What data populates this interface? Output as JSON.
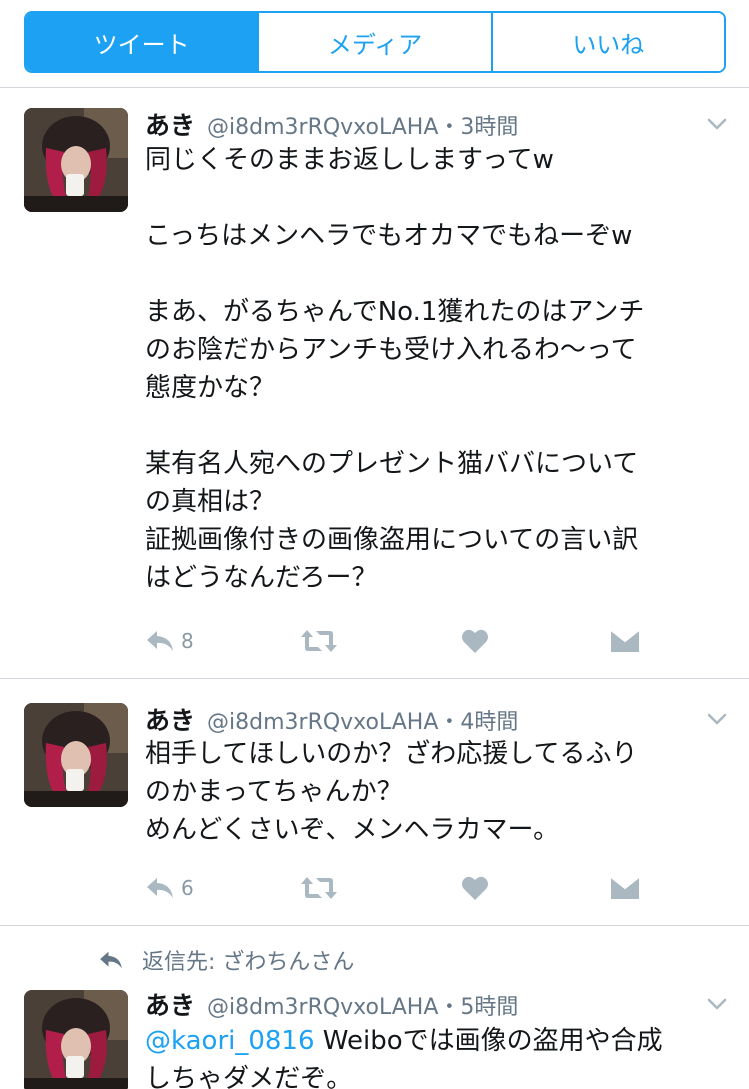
{
  "tabs": [
    {
      "label": "ツイート",
      "active": true
    },
    {
      "label": "メディア",
      "active": false
    },
    {
      "label": "いいね",
      "active": false
    }
  ],
  "tweets": [
    {
      "name": "あき",
      "handle": "@i8dm3rRQvxoLAHA・3時間",
      "lines": [
        "同じくそのままお返ししますってw",
        "",
        "こっちはメンヘラでもオカマでもねーぞw",
        "",
        "まあ、がるちゃんでNo.1獲れたのはアンチ",
        "のお陰だからアンチも受け入れるわ〜って",
        "態度かな？",
        "",
        "某有名人宛へのプレゼント猫ババについて",
        "の真相は？",
        "証拠画像付きの画像盗用についての言い訳",
        "はどうなんだろー？"
      ],
      "reply_count": "8"
    },
    {
      "name": "あき",
      "handle": "@i8dm3rRQvxoLAHA・4時間",
      "lines": [
        "相手してほしいのか？ざわ応援してるふり",
        "のかまってちゃんか？",
        "めんどくさいぞ、メンヘラカマー。"
      ],
      "reply_count": "6"
    },
    {
      "context": "返信先: ざわちんさん",
      "name": "あき",
      "handle": "@i8dm3rRQvxoLAHA・5時間",
      "mention": "@kaori_0816",
      "line1_rest": " Weiboでは画像の盗用や合成",
      "line2": "しちゃダメだぞ。"
    }
  ],
  "icons": {
    "reply": "reply-icon",
    "retweet": "retweet-icon",
    "like": "heart-icon",
    "dm": "envelope-icon",
    "caret": "chevron-down-icon"
  },
  "colors": {
    "accent": "#1da1f2",
    "action_gray": "#aab8c2",
    "meta_gray": "#657786"
  }
}
